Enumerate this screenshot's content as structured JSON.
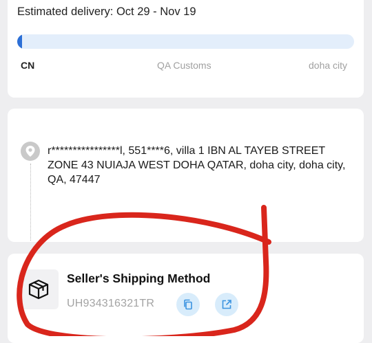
{
  "delivery": {
    "estimate_text": "Estimated delivery: Oct 29 - Nov 19",
    "progress": 0.015,
    "stages": {
      "origin": "CN",
      "customs": "QA Customs",
      "destination": "doha city"
    }
  },
  "address": {
    "text": "r****************l,  551****6,  villa 1 IBN AL TAYEB STREET ZONE 43 NUIAJA WEST DOHA QATAR,  doha city,  doha city,  QA,  47447"
  },
  "shipping": {
    "method_title": "Seller's Shipping Method",
    "tracking_number": "UH934316321TR"
  },
  "icons": {
    "location": "location-pin-icon",
    "package": "package-box-icon",
    "copy": "copy-icon",
    "open": "external-link-icon"
  },
  "colors": {
    "progress_fill": "#2c6fd6",
    "progress_track": "#e3eefb",
    "action_button_bg": "#d8ecfb",
    "action_icon": "#3b93e0",
    "annotation_red": "#d9261c"
  }
}
